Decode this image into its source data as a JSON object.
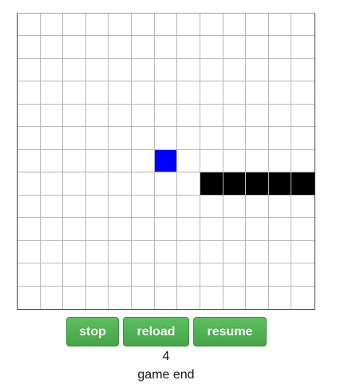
{
  "board": {
    "rows": 13,
    "cols": 13,
    "food": {
      "row": 6,
      "col": 6,
      "color": "#0000ff"
    },
    "snake": {
      "color": "#000000",
      "cells": [
        [
          7,
          8
        ],
        [
          7,
          9
        ],
        [
          7,
          10
        ],
        [
          7,
          11
        ],
        [
          7,
          12
        ]
      ]
    }
  },
  "controls": {
    "stop_label": "stop",
    "reload_label": "reload",
    "resume_label": "resume",
    "button_color": "#4cae4c"
  },
  "score": "4",
  "status": "game end"
}
